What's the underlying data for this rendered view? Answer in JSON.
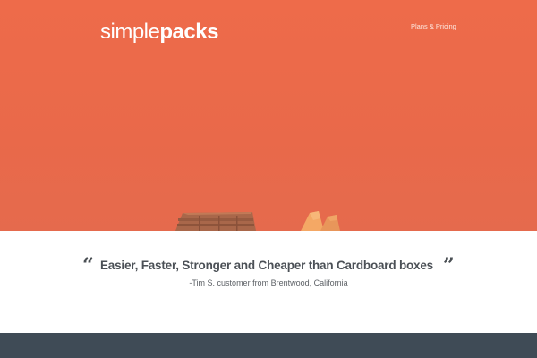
{
  "brand": {
    "light": "simple",
    "bold": "packs"
  },
  "nav": {
    "plans_link": "Plans & Pricing"
  },
  "testimonial": {
    "open_mark": "“",
    "close_mark": "”",
    "quote": "Easier, Faster, Stronger and Cheaper than Cardboard boxes",
    "attribution": "-Tim S. customer from Brentwood, California"
  },
  "colors": {
    "hero_bg": "#ee6b4a",
    "footer_bg": "#3f4b56",
    "quote_text": "#4b5056"
  }
}
